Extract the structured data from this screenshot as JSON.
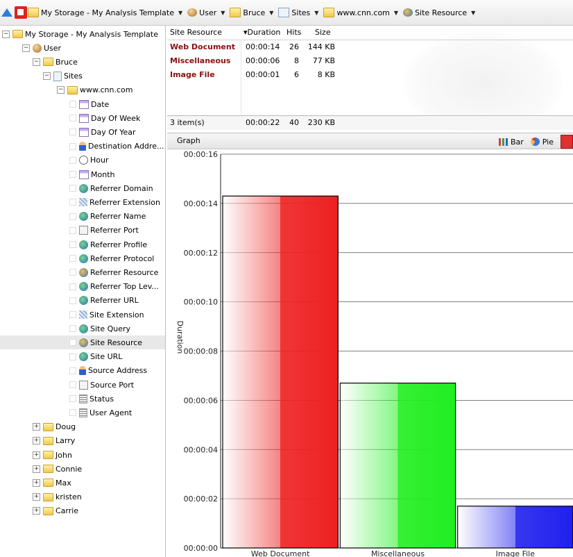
{
  "toolbar": {
    "breadcrumbs": [
      {
        "label": "My Storage - My Analysis Template",
        "icon": "folder-icon"
      },
      {
        "label": "User",
        "icon": "user-icon"
      },
      {
        "label": "Bruce",
        "icon": "folder-icon"
      },
      {
        "label": "Sites",
        "icon": "page-icon"
      },
      {
        "label": "www.cnn.com",
        "icon": "folder-icon"
      },
      {
        "label": "Site Resource",
        "icon": "globe-icon"
      }
    ]
  },
  "tree": {
    "nodes": [
      {
        "label": "My Storage - My Analysis Template",
        "depth": 0,
        "expander": "minus",
        "icon": "folder"
      },
      {
        "label": "User",
        "depth": 1,
        "expander": "minus",
        "icon": "user"
      },
      {
        "label": "Bruce",
        "depth": 2,
        "expander": "minus",
        "icon": "folder"
      },
      {
        "label": "Sites",
        "depth": 3,
        "expander": "minus",
        "icon": "page"
      },
      {
        "label": "www.cnn.com",
        "depth": 4,
        "expander": "minus",
        "icon": "folder"
      },
      {
        "label": "Date",
        "depth": 5,
        "expander": "check",
        "icon": "cal"
      },
      {
        "label": "Day Of Week",
        "depth": 5,
        "expander": "check",
        "icon": "cal"
      },
      {
        "label": "Day Of Year",
        "depth": 5,
        "expander": "check",
        "icon": "cal"
      },
      {
        "label": "Destination Addre...",
        "depth": 5,
        "expander": "check",
        "icon": "person"
      },
      {
        "label": "Hour",
        "depth": 5,
        "expander": "check",
        "icon": "clock"
      },
      {
        "label": "Month",
        "depth": 5,
        "expander": "check",
        "icon": "cal"
      },
      {
        "label": "Referrer Domain",
        "depth": 5,
        "expander": "check",
        "icon": "globe"
      },
      {
        "label": "Referrer Extension",
        "depth": 5,
        "expander": "check",
        "icon": "ext"
      },
      {
        "label": "Referrer Name",
        "depth": 5,
        "expander": "check",
        "icon": "globe"
      },
      {
        "label": "Referrer Port",
        "depth": 5,
        "expander": "check",
        "icon": "port"
      },
      {
        "label": "Referrer Profile",
        "depth": 5,
        "expander": "check",
        "icon": "globe"
      },
      {
        "label": "Referrer Protocol",
        "depth": 5,
        "expander": "check",
        "icon": "globe"
      },
      {
        "label": "Referrer Resource",
        "depth": 5,
        "expander": "check",
        "icon": "globeo"
      },
      {
        "label": "Referrer Top Lev...",
        "depth": 5,
        "expander": "check",
        "icon": "globe"
      },
      {
        "label": "Referrer URL",
        "depth": 5,
        "expander": "check",
        "icon": "globe"
      },
      {
        "label": "Site Extension",
        "depth": 5,
        "expander": "check",
        "icon": "ext"
      },
      {
        "label": "Site Query",
        "depth": 5,
        "expander": "check",
        "icon": "globe"
      },
      {
        "label": "Site Resource",
        "depth": 5,
        "expander": "check",
        "icon": "globeo",
        "selected": true
      },
      {
        "label": "Site URL",
        "depth": 5,
        "expander": "check",
        "icon": "globe"
      },
      {
        "label": "Source Address",
        "depth": 5,
        "expander": "check",
        "icon": "person"
      },
      {
        "label": "Source Port",
        "depth": 5,
        "expander": "check",
        "icon": "port"
      },
      {
        "label": "Status",
        "depth": 5,
        "expander": "check",
        "icon": "status"
      },
      {
        "label": "User Agent",
        "depth": 5,
        "expander": "check",
        "icon": "status"
      },
      {
        "label": "Doug",
        "depth": 2,
        "expander": "plus",
        "icon": "folder"
      },
      {
        "label": "Larry",
        "depth": 2,
        "expander": "plus",
        "icon": "folder"
      },
      {
        "label": "John",
        "depth": 2,
        "expander": "plus",
        "icon": "folder"
      },
      {
        "label": "Connie",
        "depth": 2,
        "expander": "plus",
        "icon": "folder"
      },
      {
        "label": "Max",
        "depth": 2,
        "expander": "plus",
        "icon": "folder"
      },
      {
        "label": "kristen",
        "depth": 2,
        "expander": "plus",
        "icon": "folder"
      },
      {
        "label": "Carrie",
        "depth": 2,
        "expander": "plus",
        "icon": "folder"
      }
    ]
  },
  "table": {
    "columns": [
      "Site Resource",
      "▾Duration",
      "Hits",
      "Size"
    ],
    "rows": [
      [
        "Web Document",
        "00:00:14",
        "26",
        "144 KB"
      ],
      [
        "Miscellaneous",
        "00:00:06",
        "8",
        "77 KB"
      ],
      [
        "Image File",
        "00:00:01",
        "6",
        "8 KB"
      ]
    ],
    "footer": [
      "3 item(s)",
      "00:00:22",
      "40",
      "230 KB"
    ]
  },
  "graph": {
    "title": "Graph",
    "bar_label": "Bar",
    "pie_label": "Pie"
  },
  "chart_data": {
    "type": "bar",
    "categories": [
      "Web Document",
      "Miscellaneous",
      "Image File"
    ],
    "values": [
      14.3,
      6.7,
      1.7
    ],
    "value_unit": "seconds",
    "ylabel": "Duration",
    "xlabel": "",
    "ylim": [
      0,
      16
    ],
    "yticks": [
      "00:00:00",
      "00:00:02",
      "00:00:04",
      "00:00:06",
      "00:00:08",
      "00:00:10",
      "00:00:12",
      "00:00:14",
      "00:00:16"
    ],
    "colors": [
      "#ee2020",
      "#20ee20",
      "#2020ee"
    ],
    "grid": true
  }
}
